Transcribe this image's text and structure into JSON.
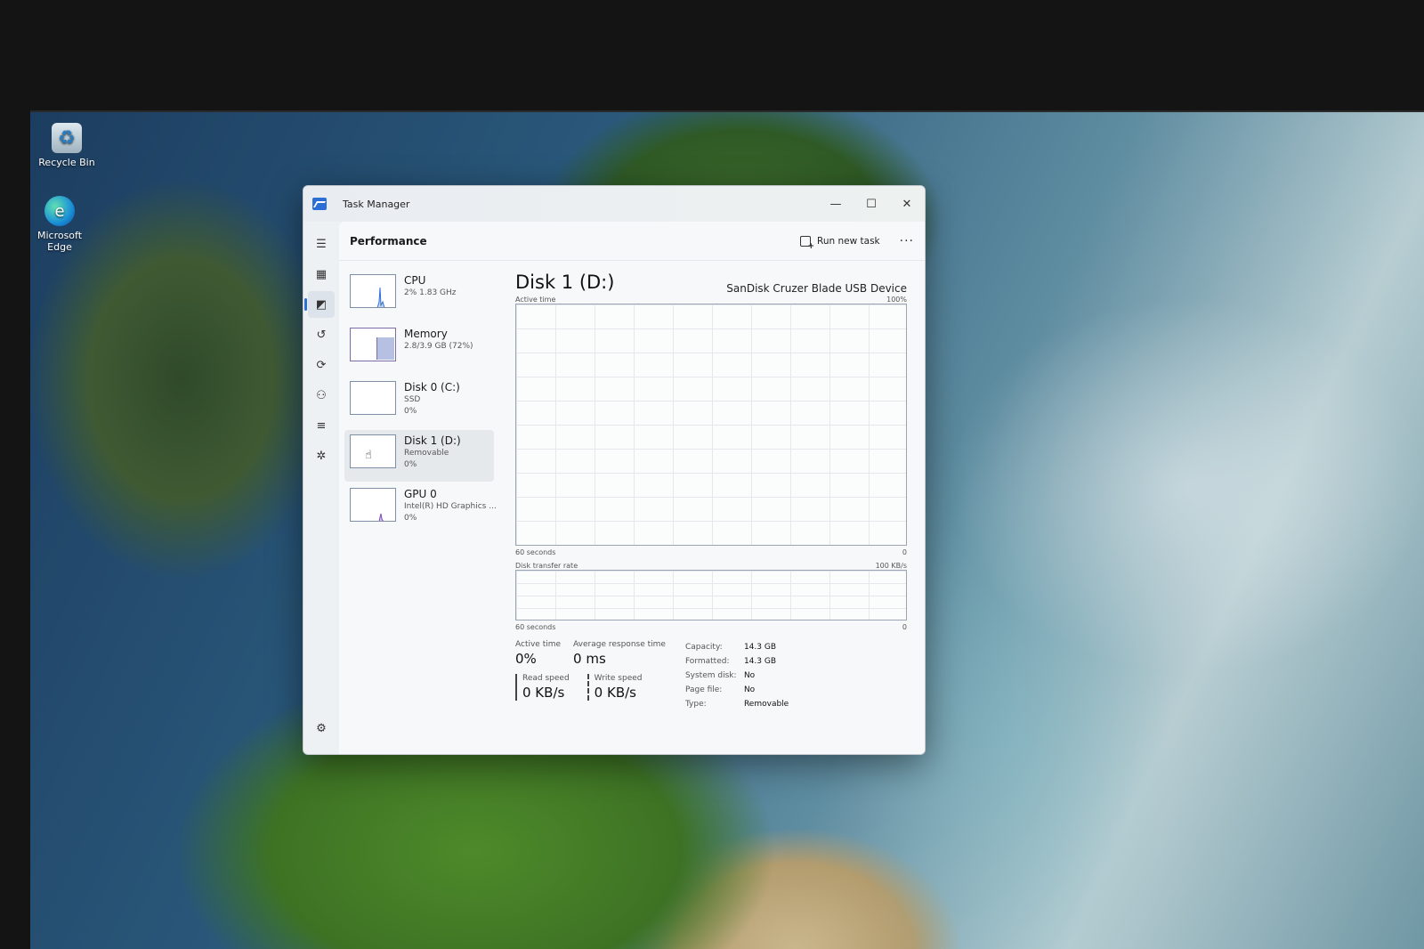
{
  "desktop": {
    "icons": [
      {
        "label": "Recycle Bin"
      },
      {
        "label": "Microsoft Edge"
      }
    ]
  },
  "window": {
    "title": "Task Manager",
    "controls": {
      "minimize": "—",
      "maximize": "☐",
      "close": "✕"
    }
  },
  "nav": {
    "icons": [
      "hamburger-menu-icon",
      "processes-icon",
      "performance-icon",
      "app-history-icon",
      "startup-apps-icon",
      "users-icon",
      "details-icon",
      "services-icon"
    ],
    "settings_icon": "gear-icon"
  },
  "header": {
    "title": "Performance",
    "run_new_task": "Run new task",
    "more": "···"
  },
  "devices": [
    {
      "name": "CPU",
      "sub1": "2% 1.83 GHz",
      "sub2": ""
    },
    {
      "name": "Memory",
      "sub1": "2.8/3.9 GB (72%)",
      "sub2": ""
    },
    {
      "name": "Disk 0 (C:)",
      "sub1": "SSD",
      "sub2": "0%"
    },
    {
      "name": "Disk 1 (D:)",
      "sub1": "Removable",
      "sub2": "0%"
    },
    {
      "name": "GPU 0",
      "sub1": "Intel(R) HD Graphics ...",
      "sub2": "0%"
    }
  ],
  "detail": {
    "title": "Disk 1 (D:)",
    "model": "SanDisk Cruzer Blade USB Device",
    "active_graph": {
      "label": "Active time",
      "max": "100%",
      "time_label": "60 seconds",
      "min": "0"
    },
    "transfer_graph": {
      "label": "Disk transfer rate",
      "max": "100 KB/s",
      "time_label": "60 seconds",
      "min": "0"
    },
    "stats": {
      "active_time_label": "Active time",
      "active_time_value": "0%",
      "avg_response_label": "Average response time",
      "avg_response_value": "0 ms",
      "read_label": "Read speed",
      "read_value": "0 KB/s",
      "write_label": "Write speed",
      "write_value": "0 KB/s"
    },
    "properties": [
      {
        "key": "Capacity:",
        "value": "14.3 GB"
      },
      {
        "key": "Formatted:",
        "value": "14.3 GB"
      },
      {
        "key": "System disk:",
        "value": "No"
      },
      {
        "key": "Page file:",
        "value": "No"
      },
      {
        "key": "Type:",
        "value": "Removable"
      }
    ]
  },
  "colors": {
    "accent": "#2b6fd6",
    "graph_border": "#9aa4b2"
  }
}
